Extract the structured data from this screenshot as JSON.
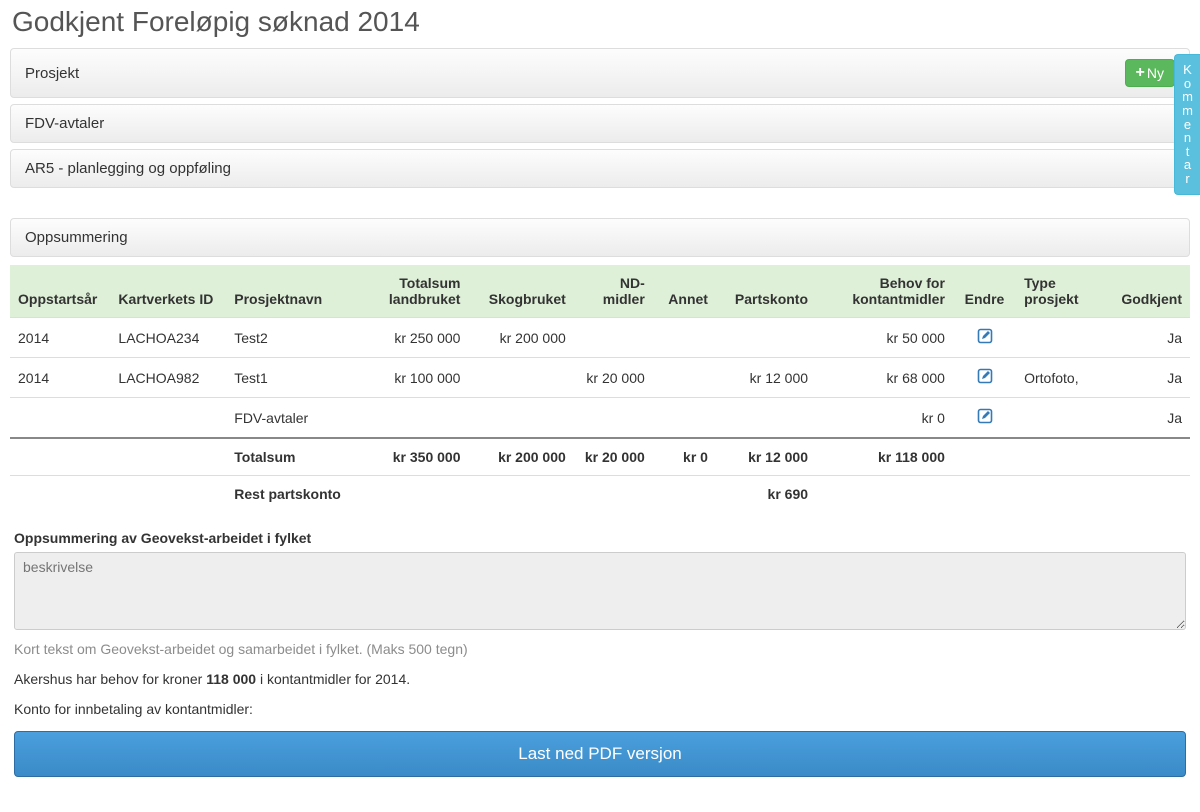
{
  "title": "Godkjent Foreløpig søknad 2014",
  "sideTab": "Kommentar",
  "panels": {
    "prosjekt": "Prosjekt",
    "fdv": "FDV-avtaler",
    "ar5": "AR5 - planlegging og oppføling",
    "summary": "Oppsummering"
  },
  "buttons": {
    "new": "Ny",
    "pdf": "Last ned PDF versjon"
  },
  "headers": {
    "startYear": "Oppstartsår",
    "kvId": "Kartverkets ID",
    "projectName": "Prosjektnavn",
    "totLand": "Totalsum landbruket",
    "skog": "Skogbruket",
    "nd": "ND-midler",
    "annet": "Annet",
    "parts": "Partskonto",
    "behov": "Behov for kontantmidler",
    "endre": "Endre",
    "type": "Type prosjekt",
    "godkjent": "Godkjent"
  },
  "rows": [
    {
      "year": "2014",
      "kvId": "LACHOA234",
      "name": "Test2",
      "land": "kr 250 000",
      "skog": "kr 200 000",
      "nd": "",
      "annet": "",
      "parts": "",
      "behov": "kr 50 000",
      "type": "",
      "godkjent": "Ja"
    },
    {
      "year": "2014",
      "kvId": "LACHOA982",
      "name": "Test1",
      "land": "kr 100 000",
      "skog": "",
      "nd": "kr 20 000",
      "annet": "",
      "parts": "kr 12 000",
      "behov": "kr 68 000",
      "type": "Ortofoto,",
      "godkjent": "Ja"
    },
    {
      "year": "",
      "kvId": "",
      "name": "FDV-avtaler",
      "land": "",
      "skog": "",
      "nd": "",
      "annet": "",
      "parts": "",
      "behov": "kr 0",
      "type": "",
      "godkjent": "Ja"
    }
  ],
  "totals": {
    "label": "Totalsum",
    "land": "kr 350 000",
    "skog": "kr 200 000",
    "nd": "kr 20 000",
    "annet": "kr 0",
    "parts": "kr 12 000",
    "behov": "kr 118 000"
  },
  "rest": {
    "label": "Rest partskonto",
    "parts": "kr 690"
  },
  "footer": {
    "descLabel": "Oppsummering av Geovekst-arbeidet i fylket",
    "placeholder": "beskrivelse",
    "help": "Kort tekst om Geovekst-arbeidet og samarbeidet i fylket. (Maks 500 tegn)",
    "need_pre": "Akershus har behov for kroner ",
    "need_amount": "118 000",
    "need_post": " i kontantmidler for 2014.",
    "account": "Konto for innbetaling av kontantmidler:"
  }
}
